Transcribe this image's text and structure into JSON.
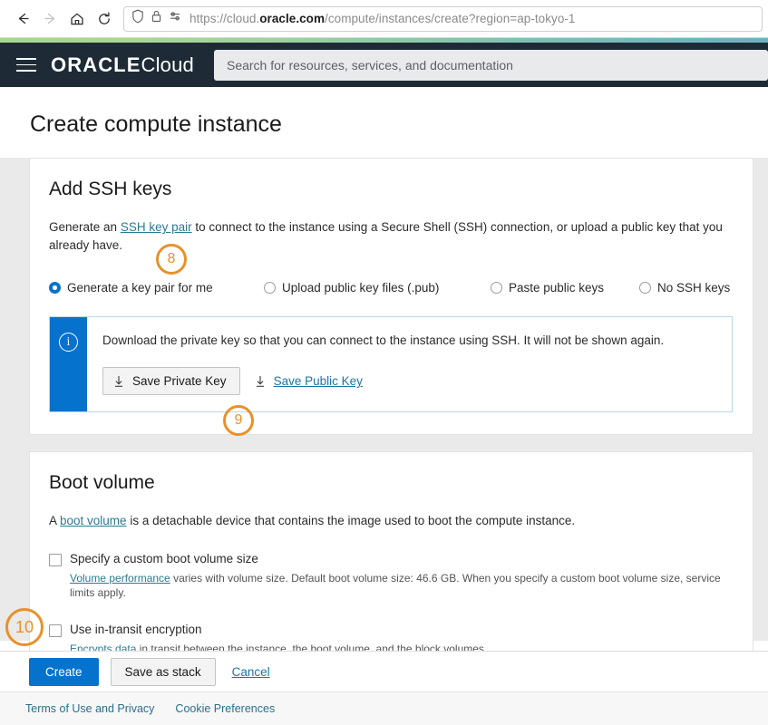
{
  "browser": {
    "back_icon": "back-arrow-icon",
    "forward_icon": "forward-arrow-icon",
    "home_icon": "home-icon",
    "reload_icon": "reload-icon",
    "shield_icon": "shield-icon",
    "lock_icon": "padlock-icon",
    "permissions_icon": "permissions-icon",
    "url_scheme": "https://cloud.",
    "url_host": "oracle.com",
    "url_path": "/compute/instances/create?region=ap-tokyo-1",
    "url_full": "https://cloud.oracle.com/compute/instances/create?region=ap-tokyo-1"
  },
  "header": {
    "menu_icon": "hamburger-menu-icon",
    "brand_primary": "ORACLE",
    "brand_secondary": "Cloud",
    "search_placeholder": "Search for resources, services, and documentation",
    "search_value": "",
    "background": "#1e2b36",
    "accent_gradient_start": "#a6d88a",
    "accent_gradient_end": "#6fb0c0"
  },
  "page": {
    "title": "Create compute instance"
  },
  "ssh": {
    "card_title": "Add SSH keys",
    "description_before": "Generate an ",
    "description_link": "SSH key pair",
    "description_after": " to connect to the instance using a Secure Shell (SSH) connection, or upload a public key that you already have.",
    "options": [
      {
        "label": "Generate a key pair for me",
        "selected": true
      },
      {
        "label": "Upload public key files (.pub)",
        "selected": false
      },
      {
        "label": "Paste public keys",
        "selected": false
      },
      {
        "label": "No SSH keys",
        "selected": false
      }
    ],
    "banner": {
      "icon": "info-icon",
      "text": "Download the private key so that you can connect to the instance using SSH. It will not be shown again.",
      "save_private_label": "Save Private Key",
      "save_public_label": "Save Public Key",
      "accent_color": "#0572ce"
    }
  },
  "boot_volume": {
    "card_title": "Boot volume",
    "description_before": "A ",
    "description_link": "boot volume",
    "description_after": " is a detachable device that contains the image used to boot the compute instance.",
    "custom_size": {
      "label": "Specify a custom boot volume size",
      "checked": false,
      "help_link": "Volume performance",
      "help_text": " varies with volume size. Default boot volume size: 46.6 GB. When you specify a custom boot volume size, service limits apply."
    },
    "in_transit": {
      "label": "Use in-transit encryption",
      "checked": false,
      "help_link": "Encrypts data",
      "help_text": " in transit between the instance, the boot volume, and the block volumes."
    }
  },
  "actions": {
    "create_label": "Create",
    "save_stack_label": "Save as stack",
    "cancel_label": "Cancel",
    "primary_color": "#0572ce"
  },
  "footer": {
    "terms_label": "Terms of Use and Privacy",
    "cookie_label": "Cookie Preferences"
  },
  "annotations": {
    "color": "#e8912a",
    "badge_8": "8",
    "badge_9": "9",
    "badge_10": "10"
  }
}
